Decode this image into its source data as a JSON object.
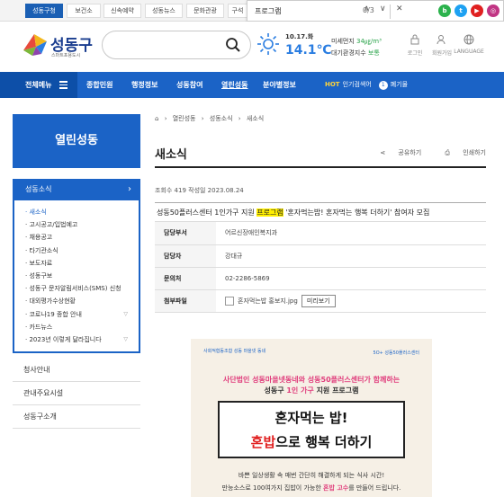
{
  "topbar": {
    "items": [
      "성동구청",
      "보건소",
      "신속예약",
      "성동뉴스",
      "문화관광",
      "구석"
    ]
  },
  "find": {
    "query": "프로그램",
    "count": "0/3",
    "up": "∧",
    "down": "∨",
    "close": "✕"
  },
  "sns": [
    "b",
    "t",
    "▶",
    "◎"
  ],
  "logo": {
    "name": "성동구",
    "sub": "스마트포용도시"
  },
  "weather": {
    "date": "10.17.화",
    "temp": "14.1℃",
    "dust_label": "미세먼지",
    "dust_value": "34㎍/m³",
    "air_label": "대기환경지수",
    "air_value": "보통"
  },
  "util": [
    "로그인",
    "회원가입",
    "LANGUAGE"
  ],
  "nav": {
    "menu": "전체메뉴",
    "items": [
      "종합민원",
      "행정정보",
      "성동참여",
      "열린성동",
      "분야별정보"
    ],
    "hot_label": "HOT",
    "hot_text": "인기검색어",
    "hot_num": "1",
    "hot_word": "폐기물"
  },
  "side": {
    "title": "열린성동",
    "category": "성동소식",
    "items": [
      "새소식",
      "고시공고/입법예고",
      "채용공고",
      "타기관소식",
      "보도자료",
      "성동구보",
      "성동구 문자알림서비스(SMS) 신청",
      "대외평가수상현황",
      "코로나19 종합 안내",
      "카드뉴스",
      "2023년 이렇게 달라집니다"
    ],
    "plain": [
      "청사안내",
      "관내주요시설",
      "성동구소개"
    ]
  },
  "content": {
    "crumb": [
      "열린성동",
      "성동소식",
      "새소식"
    ],
    "title": "새소식",
    "share": "공유하기",
    "print": "인쇄하기",
    "meta": "조회수 419 작성일 2023.08.24",
    "article_pre": "성동50플러스센터 1인가구 지원 ",
    "article_mark": "프로그램",
    "article_post": " '혼자먹는밥! 혼자먹는 행복 더하기' 참여자 모집",
    "rows": [
      {
        "label": "담당부서",
        "value": "어르신장애인복지과"
      },
      {
        "label": "담당자",
        "value": "강대규"
      },
      {
        "label": "문의처",
        "value": "02-2286-5869"
      },
      {
        "label": "첨부파일",
        "value": "혼자먹는밥 홍보지.jpg"
      }
    ],
    "preview": "미리보기"
  },
  "poster": {
    "logo_left": "사회적협동조합 성동 마을넷 동네",
    "logo_right": "5O+ 성동50플러스센터",
    "l1": "사단법인 성동마을넷동네와 성동50플러스센터가 함께하는",
    "l2_pre": "성동구 ",
    "l2_b": "1인 가구",
    "l2_post": " 지원 프로그램",
    "b1": "혼자먹는 밥!",
    "b2_pre": "",
    "b2_red": "혼밥",
    "b2_post": "으로 행복 더하기",
    "d1": "바쁜 일상생활 속 매번 간단히 해결하게 되는 식사 시간!",
    "d2_pre": "만능소스로 100여가지 집밥이 가능한 ",
    "d2_b": "혼밥 고수",
    "d2_post": "를 만들어 드립니다."
  },
  "colors": {
    "primary": "#1b63c6",
    "highlight": "#ffee00",
    "accent": "#e03d7c"
  }
}
